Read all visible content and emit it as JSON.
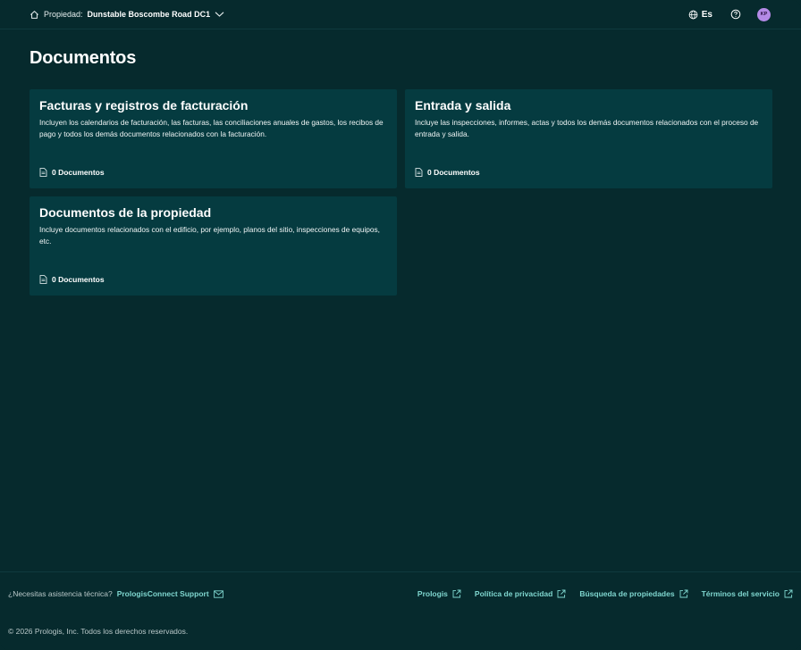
{
  "header": {
    "property_label": "Propiedad:",
    "property_name": "Dunstable Boscombe Road DC1",
    "language": "Es",
    "avatar_initials": "KP"
  },
  "page": {
    "title": "Documentos"
  },
  "cards": [
    {
      "title": "Facturas y registros de facturación",
      "description": "Incluyen los calendarios de facturación, las facturas, las conciliaciones anuales de gastos, los recibos de pago y todos los demás documentos relacionados con la facturación.",
      "count": "0 Documentos"
    },
    {
      "title": "Entrada y salida",
      "description": "Incluye las inspecciones, informes, actas y todos los demás documentos relacionados con el proceso de entrada y salida.",
      "count": "0 Documentos"
    },
    {
      "title": "Documentos de la propiedad",
      "description": "Incluye documentos relacionados con el edificio, por ejemplo, planos del sitio, inspecciones de equipos, etc.",
      "count": "0 Documentos"
    }
  ],
  "footer": {
    "assist_text": "¿Necesitas asistencia técnica?",
    "support_label": "PrologisConnect Support",
    "links": [
      "Prologis",
      "Política de privacidad",
      "Búsqueda de propiedades",
      "Términos del servicio"
    ],
    "copyright": "© 2026 Prologis, Inc. Todos los derechos reservados."
  },
  "colors": {
    "background": "#062a2d",
    "card": "#053b40",
    "accent_link": "#7fd6cf",
    "avatar": "#b48ae6"
  },
  "icons": [
    "home-icon",
    "chevron-down-icon",
    "globe-icon",
    "help-icon",
    "document-icon",
    "mail-icon",
    "external-link-icon"
  ]
}
